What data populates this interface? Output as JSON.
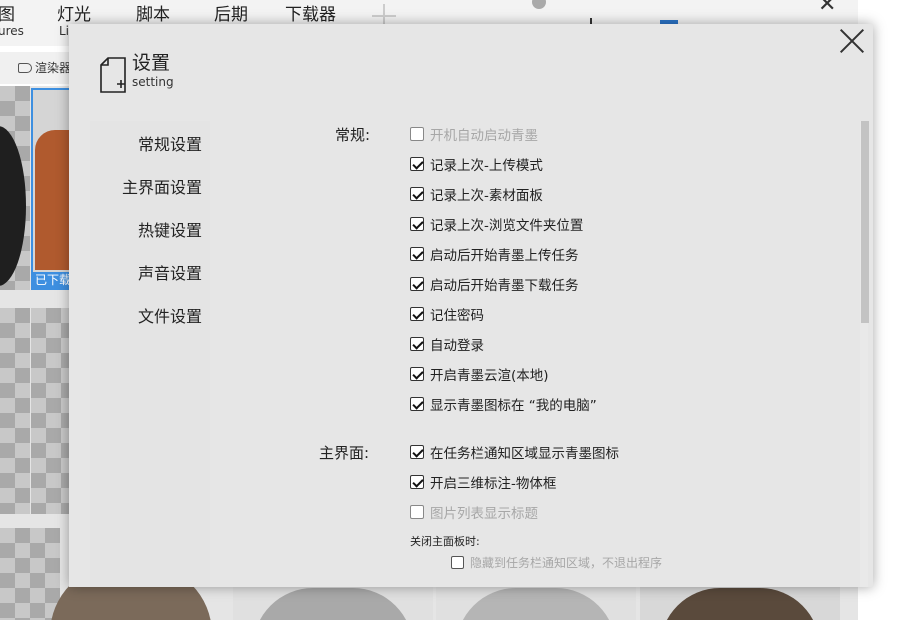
{
  "background_app": {
    "menu": [
      {
        "label": "图",
        "sub": "ures"
      },
      {
        "label": "灯光",
        "sub": "Li"
      },
      {
        "label": "脚本",
        "sub": ""
      },
      {
        "label": "后期",
        "sub": ""
      },
      {
        "label": "下载器",
        "sub": ""
      }
    ],
    "toolbar_tag": "渲染器",
    "selected_tile_label": "已下载",
    "colors": {
      "selection": "#3d8fe0"
    }
  },
  "dialog": {
    "title": "设置",
    "subtitle": "setting",
    "nav": [
      {
        "label": "常规设置"
      },
      {
        "label": "主界面设置"
      },
      {
        "label": "热键设置"
      },
      {
        "label": "声音设置"
      },
      {
        "label": "文件设置"
      }
    ],
    "sections": {
      "general_label": "常规:",
      "main_label": "主界面:"
    },
    "general_options": [
      {
        "label": "开机自动启动青墨",
        "checked": false,
        "disabled": true
      },
      {
        "label": "记录上次-上传模式",
        "checked": true,
        "disabled": false
      },
      {
        "label": "记录上次-素材面板",
        "checked": true,
        "disabled": false
      },
      {
        "label": "记录上次-浏览文件夹位置",
        "checked": true,
        "disabled": false
      },
      {
        "label": "启动后开始青墨上传任务",
        "checked": true,
        "disabled": false
      },
      {
        "label": "启动后开始青墨下载任务",
        "checked": true,
        "disabled": false
      },
      {
        "label": "记住密码",
        "checked": true,
        "disabled": false
      },
      {
        "label": "自动登录",
        "checked": true,
        "disabled": false
      },
      {
        "label": "开启青墨云渲(本地)",
        "checked": true,
        "disabled": false
      },
      {
        "label": "显示青墨图标在 “我的电脑”",
        "checked": true,
        "disabled": false
      }
    ],
    "main_options": [
      {
        "label": "在任务栏通知区域显示青墨图标",
        "checked": true,
        "disabled": false
      },
      {
        "label": "开启三维标注-物体框",
        "checked": true,
        "disabled": false
      },
      {
        "label": "图片列表显示标题",
        "checked": false,
        "disabled": true
      }
    ],
    "close_panel_heading": "关闭主面板时:",
    "close_panel_option": {
      "label": "隐藏到任务栏通知区域，不退出程序",
      "checked": false,
      "disabled": true
    }
  }
}
